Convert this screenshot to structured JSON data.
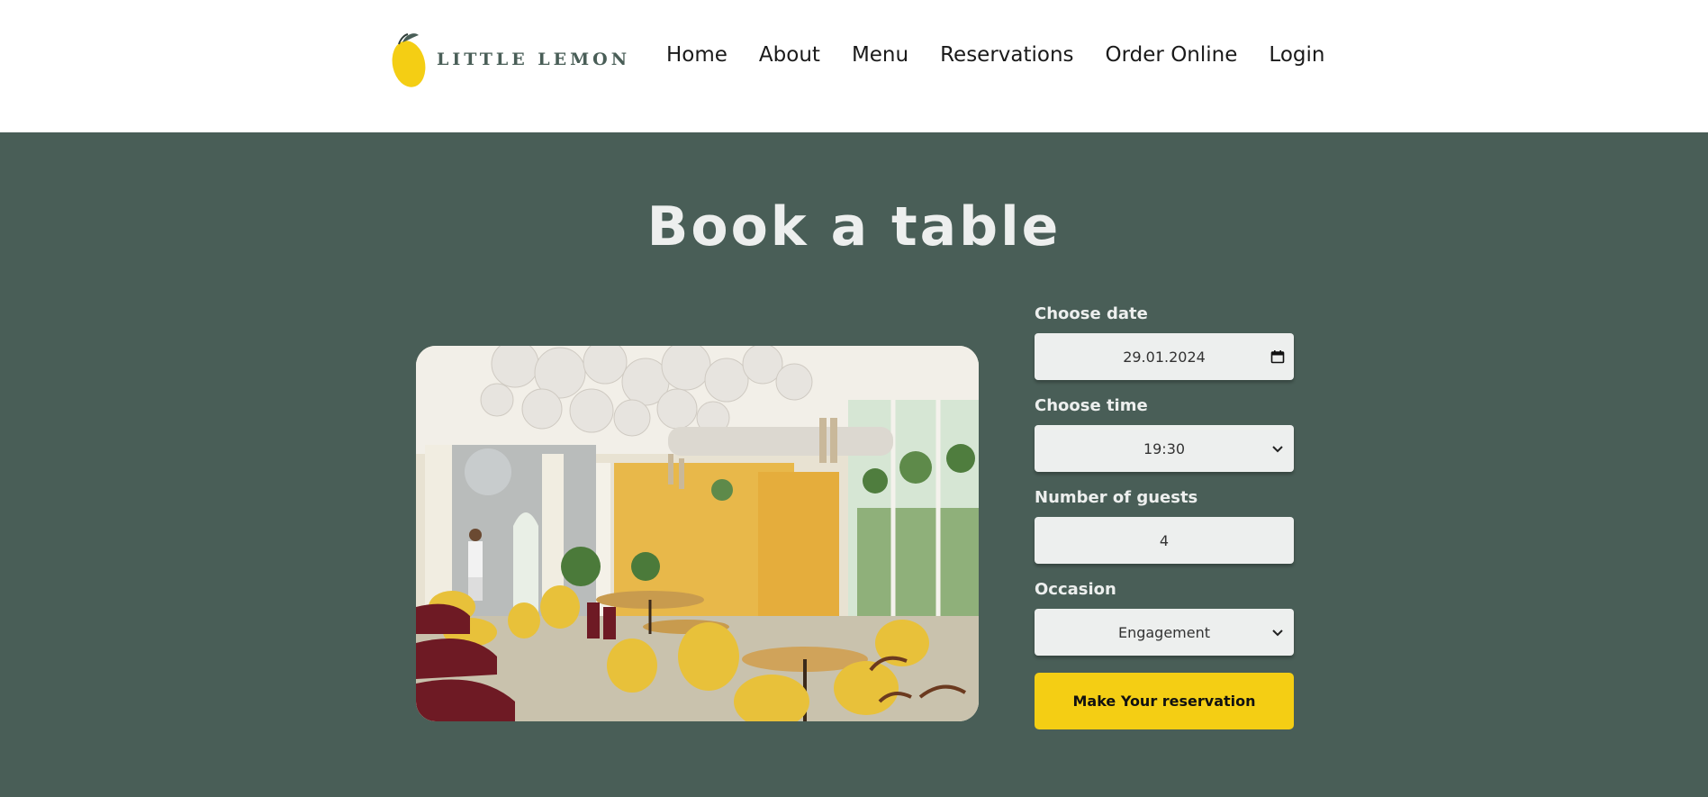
{
  "brand": {
    "name": "LITTLE LEMON",
    "primary": "#495e57",
    "accent": "#f4ce14",
    "light": "#edefee"
  },
  "nav": {
    "items": [
      {
        "label": "Home"
      },
      {
        "label": "About"
      },
      {
        "label": "Menu"
      },
      {
        "label": "Reservations"
      },
      {
        "label": "Order Online"
      },
      {
        "label": "Login"
      }
    ]
  },
  "page": {
    "title": "Book a table"
  },
  "form": {
    "date": {
      "label": "Choose date",
      "value": "29.01.2024",
      "icon": "calendar-icon"
    },
    "time": {
      "label": "Choose time",
      "value": "19:30",
      "icon": "chevron-down-icon"
    },
    "guests": {
      "label": "Number of guests",
      "value": "4"
    },
    "occasion": {
      "label": "Occasion",
      "value": "Engagement",
      "icon": "chevron-down-icon"
    },
    "submit_label": "Make Your reservation"
  }
}
